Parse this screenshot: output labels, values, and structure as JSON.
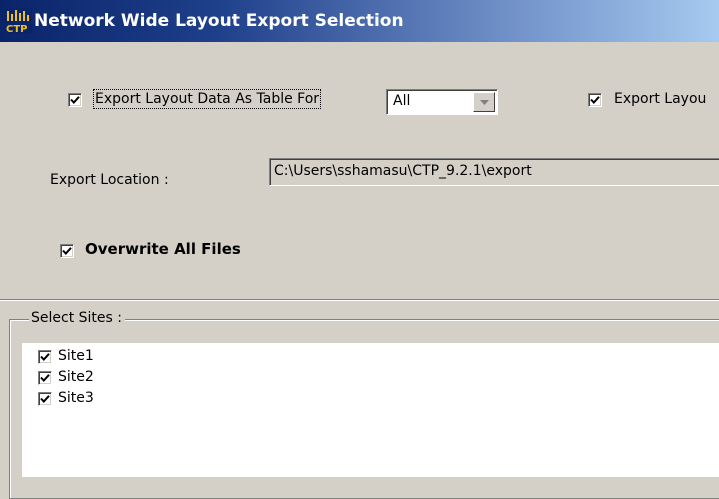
{
  "window": {
    "title": "Network Wide Layout Export Selection",
    "icon": "ctp-app-icon",
    "icon_text": "CTP"
  },
  "options": {
    "export_table": {
      "checked": true,
      "label": "Export Layout Data As Table For"
    },
    "table_scope": {
      "selected": "All"
    },
    "export_layout_partial": {
      "checked": true,
      "label": "Export Layou"
    },
    "export_location": {
      "label": "Export Location :",
      "value": "C:\\Users\\sshamasu\\CTP_9.2.1\\export"
    },
    "overwrite": {
      "checked": true,
      "label": "Overwrite All Files"
    }
  },
  "sites": {
    "group_label": "Select Sites :",
    "items": [
      {
        "label": "Site1",
        "checked": true
      },
      {
        "label": "Site2",
        "checked": true
      },
      {
        "label": "Site3",
        "checked": true
      }
    ]
  },
  "colors": {
    "title_gradient_start": "#0a246a",
    "title_gradient_end": "#a6caf0",
    "window_bg": "#d4d0c8"
  }
}
